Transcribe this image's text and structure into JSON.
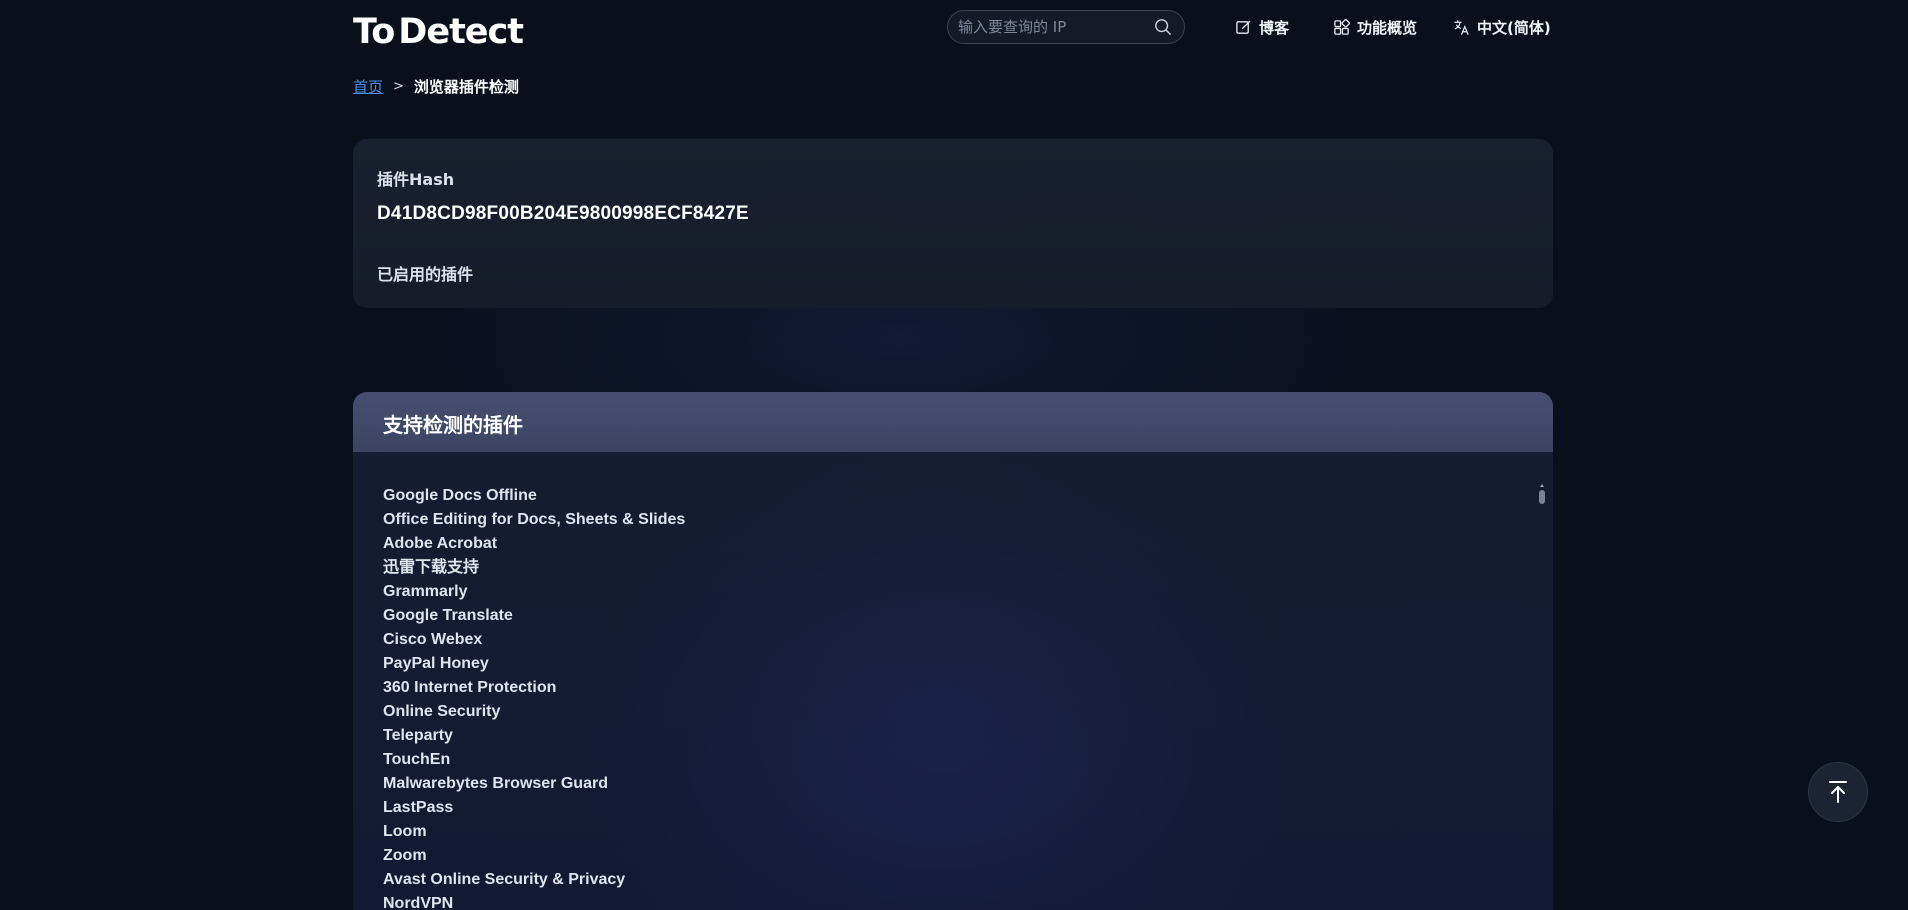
{
  "header": {
    "logo_text_1": "To",
    "logo_text_2": "Detect",
    "search_placeholder": "输入要查询的 IP",
    "nav": {
      "blog": "博客",
      "features": "功能概览",
      "language": "中文(简体)"
    }
  },
  "breadcrumb": {
    "home": "首页",
    "separator": ">",
    "current": "浏览器插件检测"
  },
  "hash_card": {
    "hash_label": "插件Hash",
    "hash_value": "D41D8CD98F00B204E9800998ECF8427E",
    "enabled_label": "已启用的插件"
  },
  "plugins_panel": {
    "title": "支持检测的插件",
    "items": [
      "Google Docs Offline",
      "Office Editing for Docs, Sheets & Slides",
      "Adobe Acrobat",
      "迅雷下载支持",
      "Grammarly",
      "Google Translate",
      "Cisco Webex",
      "PayPal Honey",
      "360 Internet Protection",
      "Online Security",
      "Teleparty",
      "TouchEn",
      "Malwarebytes Browser Guard",
      "LastPass",
      "Loom",
      "Zoom",
      "Avast Online Security & Privacy",
      "NordVPN"
    ]
  },
  "colors": {
    "background": "#0a0f1c",
    "card": "#181f2e",
    "panel_header": "#434c6b",
    "link": "#4a8ff0",
    "logo_accent": "#4db3ff"
  }
}
